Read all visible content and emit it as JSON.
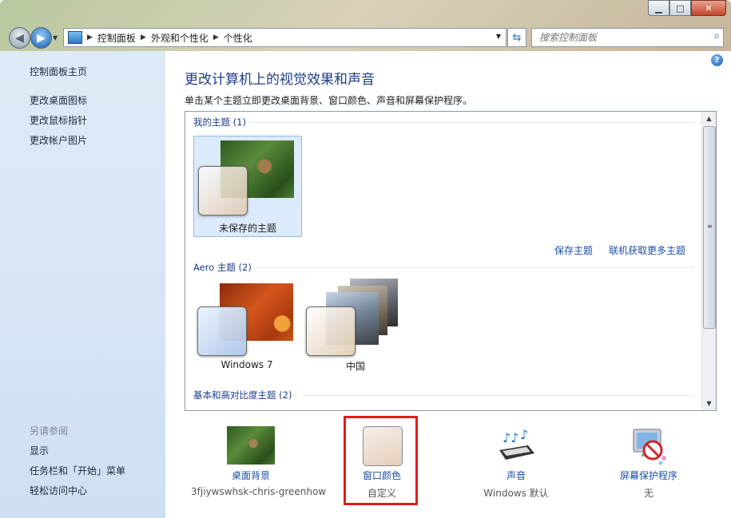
{
  "window": {
    "minimize_icon": "minimize",
    "maximize_icon": "maximize",
    "close_icon": "close"
  },
  "nav": {
    "breadcrumbs": [
      "控制面板",
      "外观和个性化",
      "个性化"
    ],
    "search_placeholder": "搜索控制面板"
  },
  "sidebar": {
    "home": "控制面板主页",
    "links": [
      "更改桌面图标",
      "更改鼠标指针",
      "更改帐户图片"
    ],
    "see_also_heading": "另请参阅",
    "see_also": [
      "显示",
      "任务栏和「开始」菜单",
      "轻松访问中心"
    ]
  },
  "main": {
    "title": "更改计算机上的视觉效果和声音",
    "subtitle": "单击某个主题立即更改桌面背景、窗口颜色、声音和屏幕保护程序。",
    "groups": {
      "my_themes": "我的主题 (1)",
      "aero_themes": "Aero 主题 (2)",
      "basic_themes": "基本和高对比度主题 (2)"
    },
    "themes": {
      "unsaved": "未保存的主题",
      "windows7": "Windows 7",
      "china": "中国"
    },
    "save_theme": "保存主题",
    "more_themes": "联机获取更多主题"
  },
  "settings": {
    "desktop_background": {
      "label": "桌面背景",
      "value": "3fjiywswhsk-chris-greenhow"
    },
    "window_color": {
      "label": "窗口颜色",
      "value": "自定义"
    },
    "sound": {
      "label": "声音",
      "value": "Windows 默认"
    },
    "screensaver": {
      "label": "屏幕保护程序",
      "value": "无"
    }
  },
  "colors": {
    "highlight_box": "#e21b1b",
    "link": "#1d4fa2",
    "title": "#1d3d8a"
  }
}
